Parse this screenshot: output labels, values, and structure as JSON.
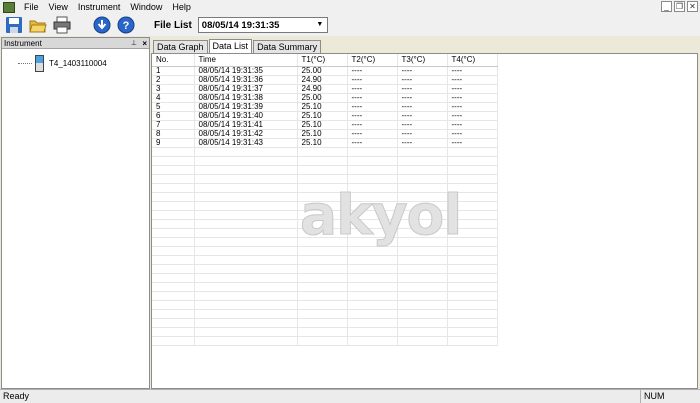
{
  "menu": [
    "File",
    "View",
    "Instrument",
    "Window",
    "Help"
  ],
  "toolbar": {
    "icons": [
      "save-icon",
      "open-folder-icon",
      "print-icon",
      "download-icon",
      "help-icon"
    ],
    "file_list_label": "File List",
    "file_list_value": "08/05/14 19:31:35"
  },
  "instrument_panel": {
    "title": "Instrument",
    "device": "T4_1403110004"
  },
  "tabs": [
    "Data Graph",
    "Data List",
    "Data Summary"
  ],
  "active_tab": "Data List",
  "table": {
    "columns": [
      "No.",
      "Time",
      "T1(°C)",
      "T2(°C)",
      "T3(°C)",
      "T4(°C)"
    ],
    "rows": [
      [
        "1",
        "08/05/14 19:31:35",
        "25.00",
        "----",
        "----",
        "----"
      ],
      [
        "2",
        "08/05/14 19:31:36",
        "24.90",
        "----",
        "----",
        "----"
      ],
      [
        "3",
        "08/05/14 19:31:37",
        "24.90",
        "----",
        "----",
        "----"
      ],
      [
        "4",
        "08/05/14 19:31:38",
        "25.00",
        "----",
        "----",
        "----"
      ],
      [
        "5",
        "08/05/14 19:31:39",
        "25.10",
        "----",
        "----",
        "----"
      ],
      [
        "6",
        "08/05/14 19:31:40",
        "25.10",
        "----",
        "----",
        "----"
      ],
      [
        "7",
        "08/05/14 19:31:41",
        "25.10",
        "----",
        "----",
        "----"
      ],
      [
        "8",
        "08/05/14 19:31:42",
        "25.10",
        "----",
        "----",
        "----"
      ],
      [
        "9",
        "08/05/14 19:31:43",
        "25.10",
        "----",
        "----",
        "----"
      ]
    ]
  },
  "watermark": "akyol",
  "status": {
    "text": "Ready",
    "num": "NUM"
  }
}
